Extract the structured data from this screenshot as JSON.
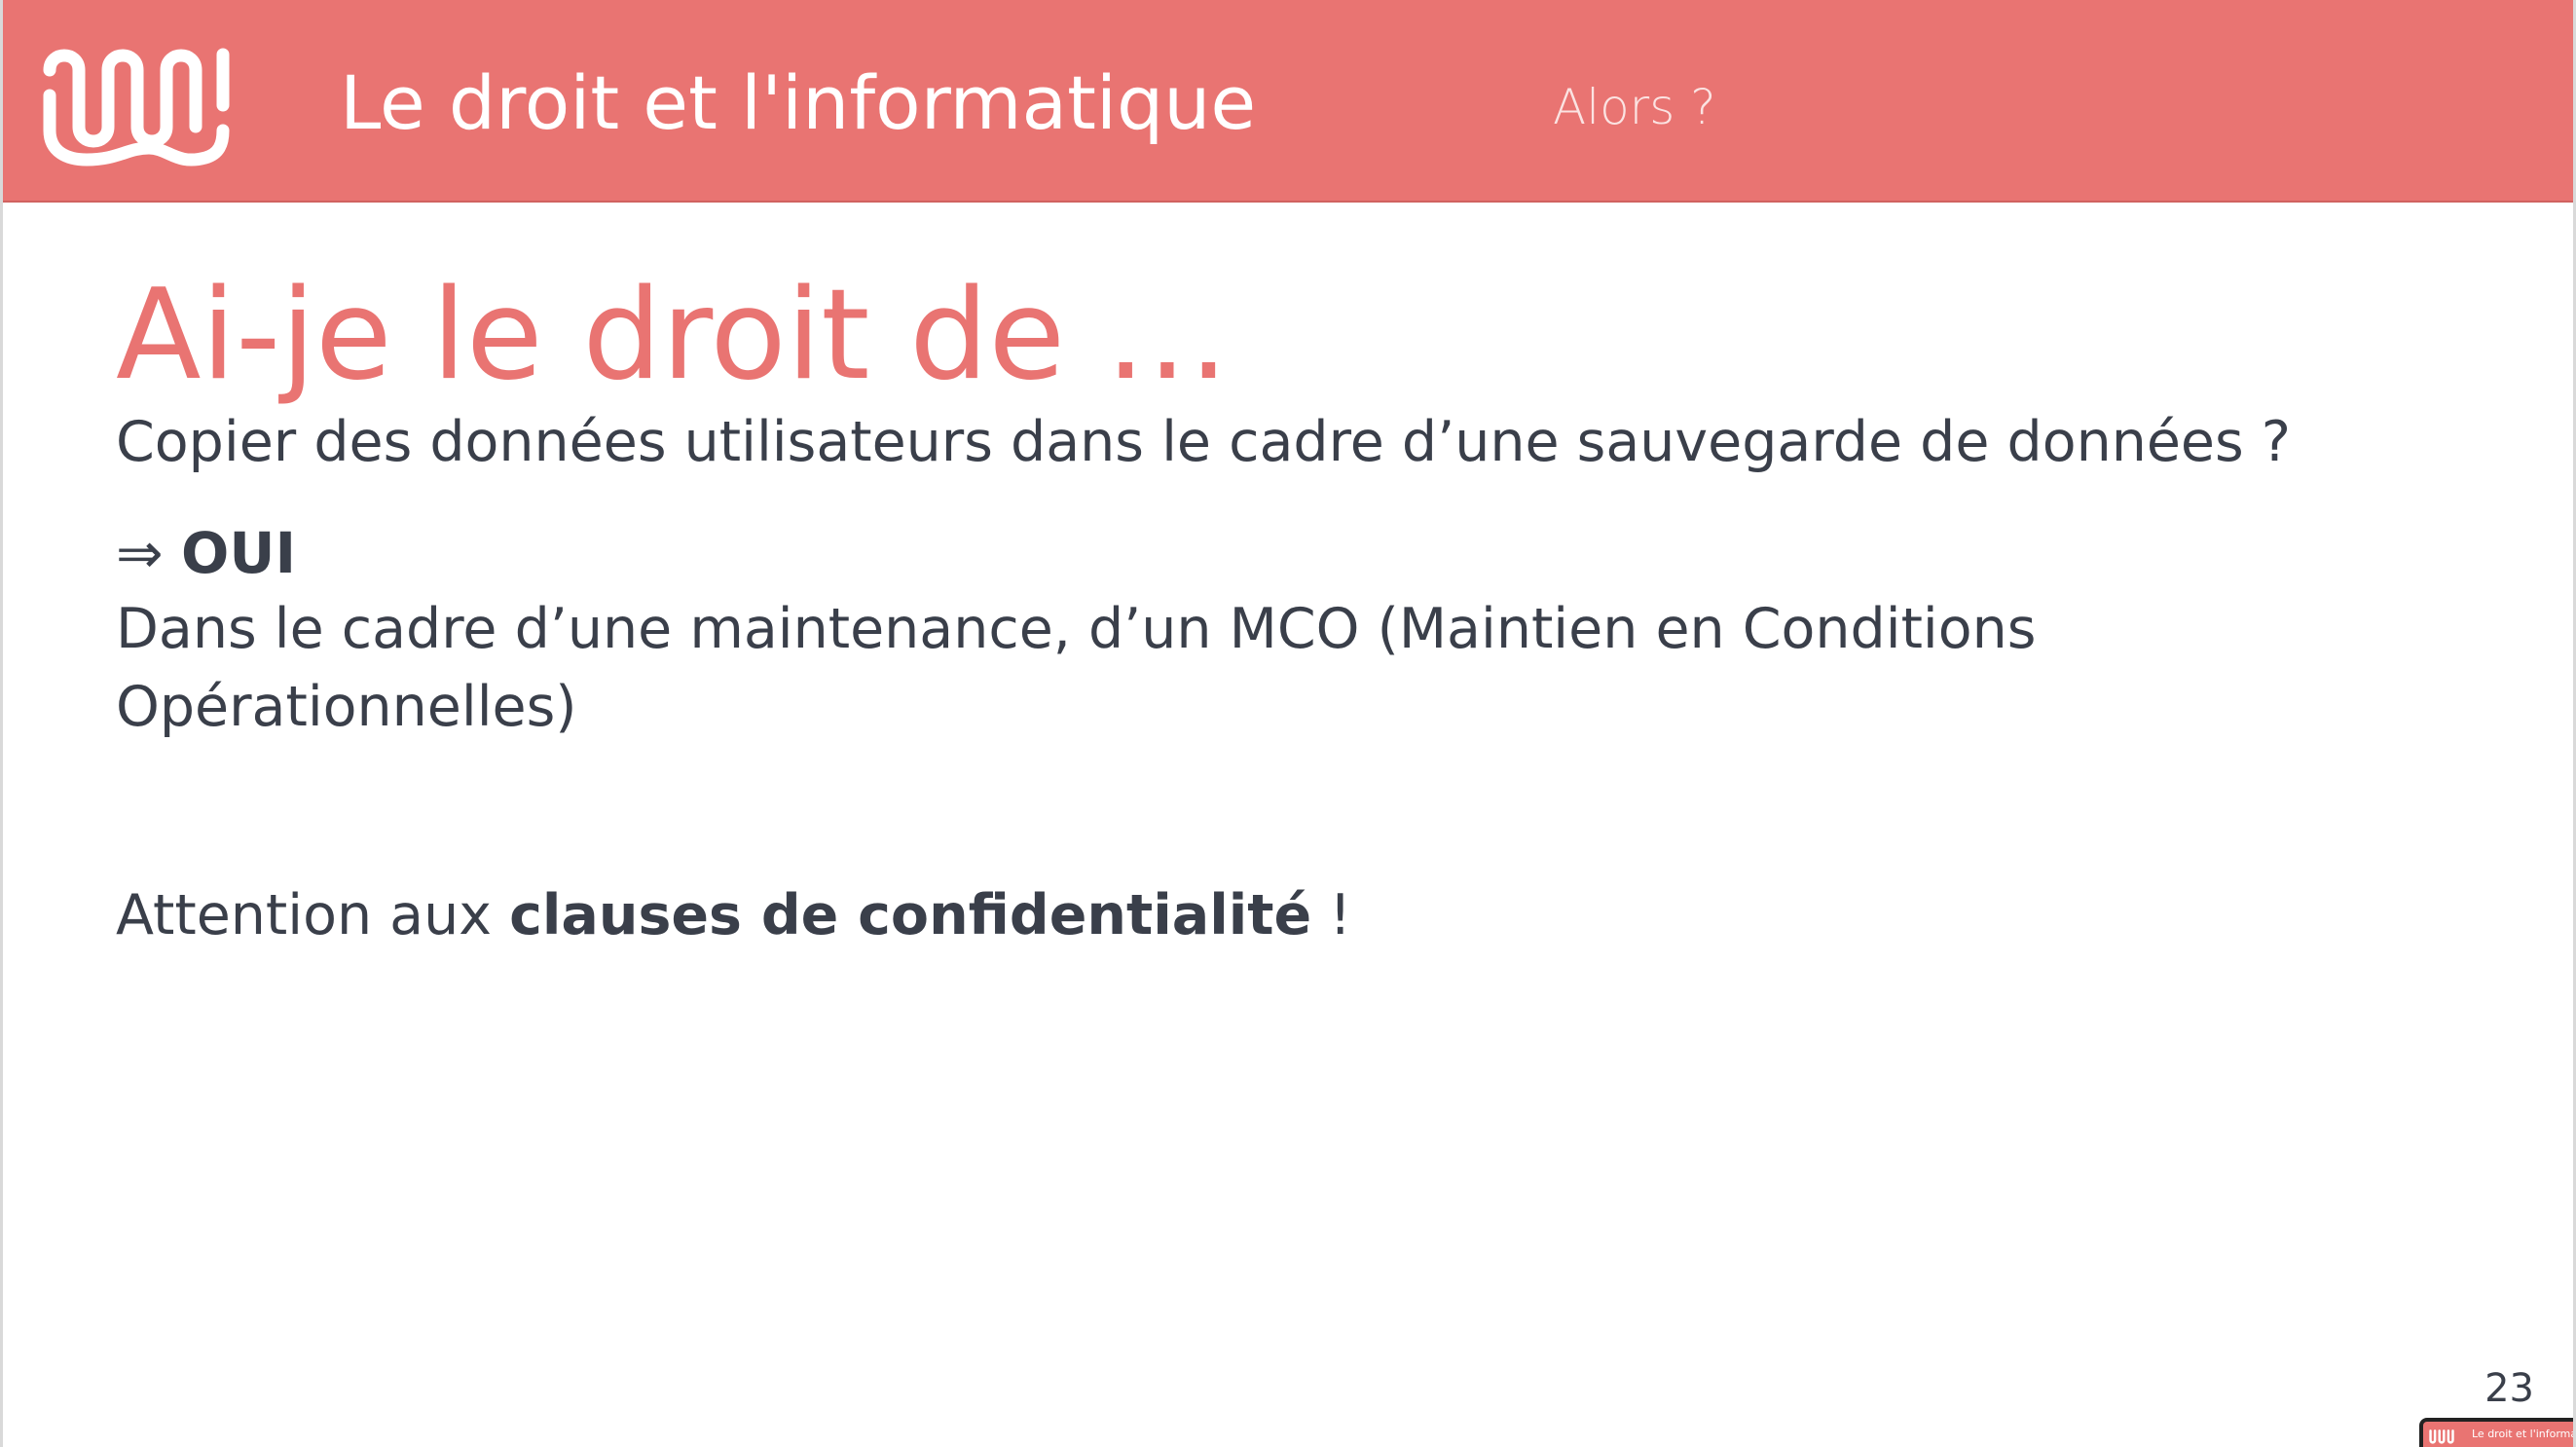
{
  "header": {
    "title": "Le droit et l'informatique",
    "section": "Alors ?",
    "logo_icon": "wavy-lines-logo-icon",
    "color": "#e97472"
  },
  "main": {
    "title": "Ai-je le droit de …",
    "question": "Copier des données utilisateurs dans le cadre d’une sauvegarde de données ?",
    "answer_arrow": "⇒",
    "answer_label": "OUI",
    "explanation": "Dans le cadre d’une maintenance, d’un MCO (Maintien en Conditions Opérationnelles)",
    "warning_prefix": "Attention aux ",
    "warning_bold": "clauses de confidentialité",
    "warning_suffix": " !"
  },
  "footer": {
    "page_number": "23",
    "thumbnail_title": "Le droit et l'informati"
  },
  "colors": {
    "accent": "#e97472",
    "text": "#3a3f4a",
    "background": "#ffffff"
  }
}
